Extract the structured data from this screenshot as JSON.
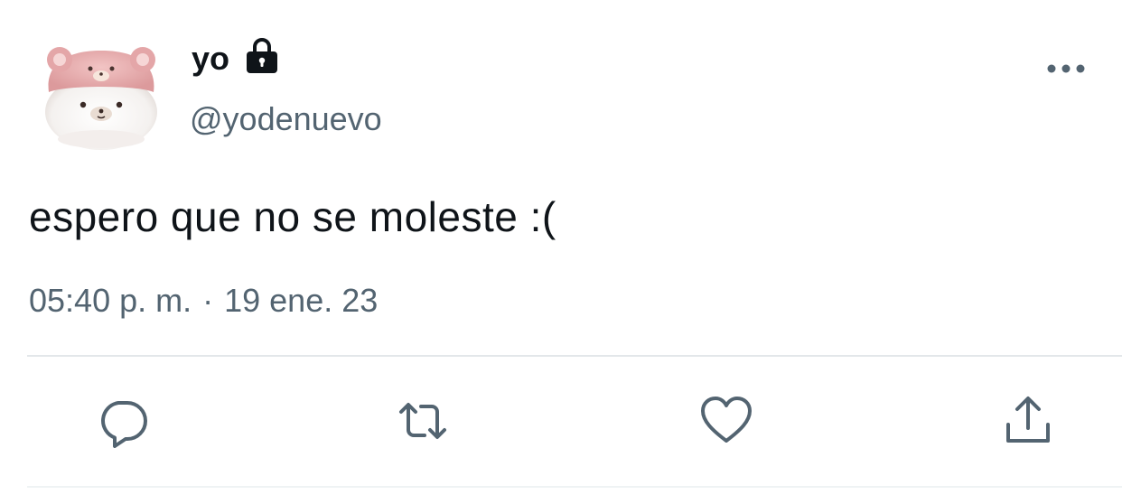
{
  "tweet": {
    "display_name": "yo",
    "handle": "@yodenuevo",
    "text": "espero que no se moleste :(",
    "time": "05:40 p. m.",
    "separator": "·",
    "date": "19 ene. 23",
    "protected": true
  },
  "icons": {
    "lock": "lock-icon",
    "more": "more-horizontal-icon",
    "reply": "reply-icon",
    "retweet": "retweet-icon",
    "like": "heart-icon",
    "share": "share-icon"
  },
  "colors": {
    "text_primary": "#0f1419",
    "text_secondary": "#536471",
    "divider": "#e3e7ea",
    "icon": "#536471"
  }
}
